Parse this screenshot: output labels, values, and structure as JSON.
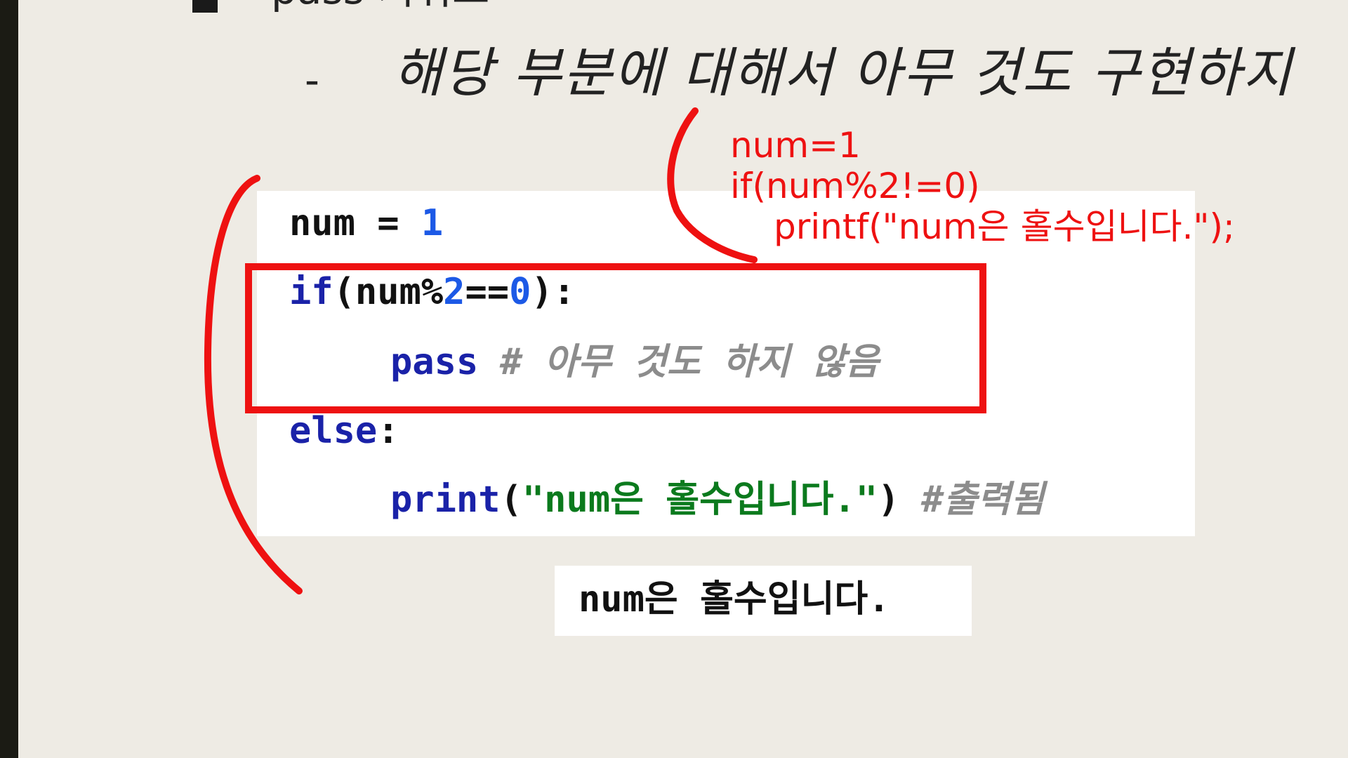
{
  "heading": {
    "text": "pass 키워드"
  },
  "subline": {
    "dash": "-",
    "text": "해당 부분에 대해서 아무 것도 구현하지"
  },
  "code": {
    "line1": {
      "var": "num",
      "op": " = ",
      "num": "1"
    },
    "line2": {
      "kw": "if",
      "open": "(num%",
      "num2": "2",
      "eq": "==",
      "num0": "0",
      "close": "):"
    },
    "line3": {
      "kw": "pass",
      "comment": " # 아무 것도 하지 않음"
    },
    "line4": {
      "kw": "else",
      "colon": ":"
    },
    "line5": {
      "func": "print",
      "open": "(",
      "str": "\"num은 홀수입니다.\"",
      "close": ")",
      "comment": " #출력됨"
    }
  },
  "output": {
    "text": "num은 홀수입니다."
  },
  "annotation": {
    "line1": "num=1",
    "line2": "if(num%2!=0)",
    "line3": "printf(\"num은 홀수입니다.\");"
  },
  "colors": {
    "background": "#eeebe4",
    "keyword": "#1a22a8",
    "number": "#1c59e6",
    "string": "#0b7a1d",
    "comment": "#8c8c8c",
    "annotation": "#ee1111"
  }
}
